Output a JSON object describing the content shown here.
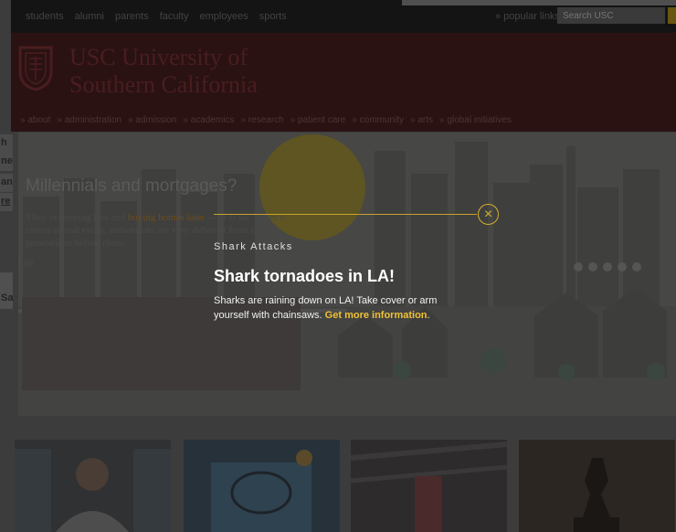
{
  "audience_nav": [
    "students",
    "alumni",
    "parents",
    "faculty",
    "employees",
    "sports"
  ],
  "popular_links": "» popular links",
  "search": {
    "placeholder": "Search USC"
  },
  "logo": {
    "line1": "USC University of",
    "line2": "Southern California"
  },
  "main_nav": [
    "» about",
    "» administration",
    "» admission",
    "» academics",
    "» research",
    "» patient care",
    "» community",
    "» arts",
    "» global initiatives"
  ],
  "left_fragments": [
    "h",
    "ne",
    "an",
    "re",
    "Sa"
  ],
  "hero": {
    "heading": "Millennials and mortgages?",
    "body_pre": "They’re moving less and ",
    "body_link": "buying homes later",
    "body_post": " — if at all. When it comes to real estate, millennials are very different from the generations before them.",
    "edit": "Edit"
  },
  "modal": {
    "eyebrow": "Shark Attacks",
    "title": "Shark tornadoes in LA!",
    "body_text": "Sharks are raining down on LA! Take cover or arm yourself with chainsaws. ",
    "link_text": "Get more information",
    "body_end": ".",
    "close_glyph": "×"
  },
  "colors": {
    "accent_gold": "#f0c233",
    "usc_cardinal": "#990000"
  }
}
